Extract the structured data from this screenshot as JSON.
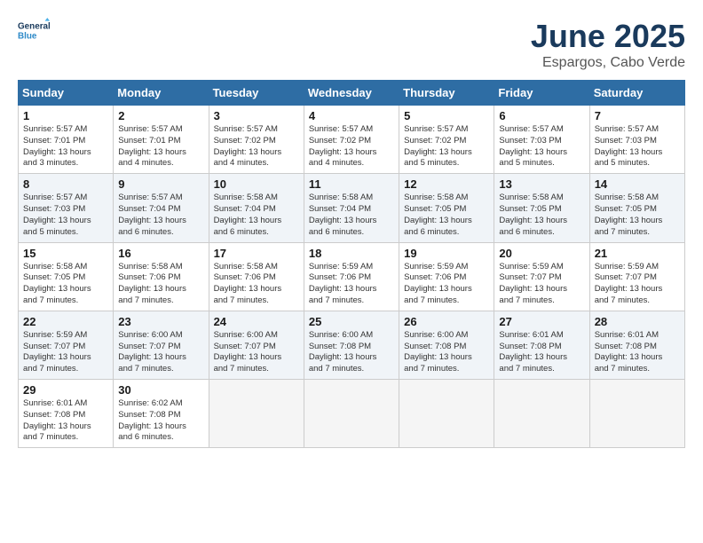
{
  "header": {
    "logo_line1": "General",
    "logo_line2": "Blue",
    "month_year": "June 2025",
    "location": "Espargos, Cabo Verde"
  },
  "columns": [
    "Sunday",
    "Monday",
    "Tuesday",
    "Wednesday",
    "Thursday",
    "Friday",
    "Saturday"
  ],
  "weeks": [
    [
      {
        "day": "1",
        "lines": [
          "Sunrise: 5:57 AM",
          "Sunset: 7:01 PM",
          "Daylight: 13 hours",
          "and 3 minutes."
        ]
      },
      {
        "day": "2",
        "lines": [
          "Sunrise: 5:57 AM",
          "Sunset: 7:01 PM",
          "Daylight: 13 hours",
          "and 4 minutes."
        ]
      },
      {
        "day": "3",
        "lines": [
          "Sunrise: 5:57 AM",
          "Sunset: 7:02 PM",
          "Daylight: 13 hours",
          "and 4 minutes."
        ]
      },
      {
        "day": "4",
        "lines": [
          "Sunrise: 5:57 AM",
          "Sunset: 7:02 PM",
          "Daylight: 13 hours",
          "and 4 minutes."
        ]
      },
      {
        "day": "5",
        "lines": [
          "Sunrise: 5:57 AM",
          "Sunset: 7:02 PM",
          "Daylight: 13 hours",
          "and 5 minutes."
        ]
      },
      {
        "day": "6",
        "lines": [
          "Sunrise: 5:57 AM",
          "Sunset: 7:03 PM",
          "Daylight: 13 hours",
          "and 5 minutes."
        ]
      },
      {
        "day": "7",
        "lines": [
          "Sunrise: 5:57 AM",
          "Sunset: 7:03 PM",
          "Daylight: 13 hours",
          "and 5 minutes."
        ]
      }
    ],
    [
      {
        "day": "8",
        "lines": [
          "Sunrise: 5:57 AM",
          "Sunset: 7:03 PM",
          "Daylight: 13 hours",
          "and 5 minutes."
        ]
      },
      {
        "day": "9",
        "lines": [
          "Sunrise: 5:57 AM",
          "Sunset: 7:04 PM",
          "Daylight: 13 hours",
          "and 6 minutes."
        ]
      },
      {
        "day": "10",
        "lines": [
          "Sunrise: 5:58 AM",
          "Sunset: 7:04 PM",
          "Daylight: 13 hours",
          "and 6 minutes."
        ]
      },
      {
        "day": "11",
        "lines": [
          "Sunrise: 5:58 AM",
          "Sunset: 7:04 PM",
          "Daylight: 13 hours",
          "and 6 minutes."
        ]
      },
      {
        "day": "12",
        "lines": [
          "Sunrise: 5:58 AM",
          "Sunset: 7:05 PM",
          "Daylight: 13 hours",
          "and 6 minutes."
        ]
      },
      {
        "day": "13",
        "lines": [
          "Sunrise: 5:58 AM",
          "Sunset: 7:05 PM",
          "Daylight: 13 hours",
          "and 6 minutes."
        ]
      },
      {
        "day": "14",
        "lines": [
          "Sunrise: 5:58 AM",
          "Sunset: 7:05 PM",
          "Daylight: 13 hours",
          "and 7 minutes."
        ]
      }
    ],
    [
      {
        "day": "15",
        "lines": [
          "Sunrise: 5:58 AM",
          "Sunset: 7:05 PM",
          "Daylight: 13 hours",
          "and 7 minutes."
        ]
      },
      {
        "day": "16",
        "lines": [
          "Sunrise: 5:58 AM",
          "Sunset: 7:06 PM",
          "Daylight: 13 hours",
          "and 7 minutes."
        ]
      },
      {
        "day": "17",
        "lines": [
          "Sunrise: 5:58 AM",
          "Sunset: 7:06 PM",
          "Daylight: 13 hours",
          "and 7 minutes."
        ]
      },
      {
        "day": "18",
        "lines": [
          "Sunrise: 5:59 AM",
          "Sunset: 7:06 PM",
          "Daylight: 13 hours",
          "and 7 minutes."
        ]
      },
      {
        "day": "19",
        "lines": [
          "Sunrise: 5:59 AM",
          "Sunset: 7:06 PM",
          "Daylight: 13 hours",
          "and 7 minutes."
        ]
      },
      {
        "day": "20",
        "lines": [
          "Sunrise: 5:59 AM",
          "Sunset: 7:07 PM",
          "Daylight: 13 hours",
          "and 7 minutes."
        ]
      },
      {
        "day": "21",
        "lines": [
          "Sunrise: 5:59 AM",
          "Sunset: 7:07 PM",
          "Daylight: 13 hours",
          "and 7 minutes."
        ]
      }
    ],
    [
      {
        "day": "22",
        "lines": [
          "Sunrise: 5:59 AM",
          "Sunset: 7:07 PM",
          "Daylight: 13 hours",
          "and 7 minutes."
        ]
      },
      {
        "day": "23",
        "lines": [
          "Sunrise: 6:00 AM",
          "Sunset: 7:07 PM",
          "Daylight: 13 hours",
          "and 7 minutes."
        ]
      },
      {
        "day": "24",
        "lines": [
          "Sunrise: 6:00 AM",
          "Sunset: 7:07 PM",
          "Daylight: 13 hours",
          "and 7 minutes."
        ]
      },
      {
        "day": "25",
        "lines": [
          "Sunrise: 6:00 AM",
          "Sunset: 7:08 PM",
          "Daylight: 13 hours",
          "and 7 minutes."
        ]
      },
      {
        "day": "26",
        "lines": [
          "Sunrise: 6:00 AM",
          "Sunset: 7:08 PM",
          "Daylight: 13 hours",
          "and 7 minutes."
        ]
      },
      {
        "day": "27",
        "lines": [
          "Sunrise: 6:01 AM",
          "Sunset: 7:08 PM",
          "Daylight: 13 hours",
          "and 7 minutes."
        ]
      },
      {
        "day": "28",
        "lines": [
          "Sunrise: 6:01 AM",
          "Sunset: 7:08 PM",
          "Daylight: 13 hours",
          "and 7 minutes."
        ]
      }
    ],
    [
      {
        "day": "29",
        "lines": [
          "Sunrise: 6:01 AM",
          "Sunset: 7:08 PM",
          "Daylight: 13 hours",
          "and 7 minutes."
        ]
      },
      {
        "day": "30",
        "lines": [
          "Sunrise: 6:02 AM",
          "Sunset: 7:08 PM",
          "Daylight: 13 hours",
          "and 6 minutes."
        ]
      },
      null,
      null,
      null,
      null,
      null
    ]
  ]
}
